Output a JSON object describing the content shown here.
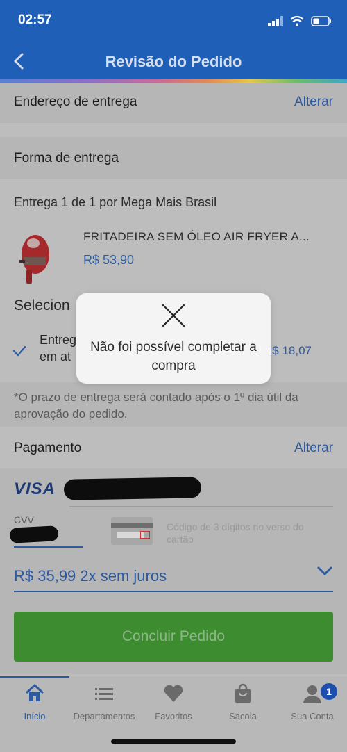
{
  "status": {
    "time": "02:57"
  },
  "header": {
    "title": "Revisão do Pedido"
  },
  "address": {
    "title": "Endereço de entrega",
    "change": "Alterar"
  },
  "delivery": {
    "title": "Forma de entrega",
    "shipment": "Entrega 1 de 1",
    "seller": "por Mega Mais Brasil",
    "product_name": "FRITADEIRA SEM ÓLEO AIR FRYER A...",
    "product_price": "R$ 53,90",
    "select_prefix": "Selecion",
    "option_prefix_1": "Entreg",
    "option_prefix_2": "em at",
    "option_price": "R$ 18,07",
    "note": "*O prazo de entrega será contado após o 1º dia útil da aprovação do pedido."
  },
  "payment": {
    "title": "Pagamento",
    "change": "Alterar",
    "card_brand": "VISA",
    "cvv_label": "CVV",
    "cvv_hint": "Código de 3 dígitos no verso do cartão",
    "installments": "R$ 35,99 2x sem juros"
  },
  "cta": {
    "label": "Concluir Pedido"
  },
  "modal": {
    "message": "Não foi possível completar a compra"
  },
  "tabs": [
    {
      "label": "Início",
      "icon": "home-icon"
    },
    {
      "label": "Departamentos",
      "icon": "list-icon"
    },
    {
      "label": "Favoritos",
      "icon": "heart-icon"
    },
    {
      "label": "Sacola",
      "icon": "bag-icon"
    },
    {
      "label": "Sua Conta",
      "icon": "user-icon",
      "badge": "1"
    }
  ],
  "colors": {
    "header": "#1f5fb8",
    "accent": "#2c5aa0",
    "cta": "#3d8c2f",
    "overlay": "#bdbdbd"
  }
}
